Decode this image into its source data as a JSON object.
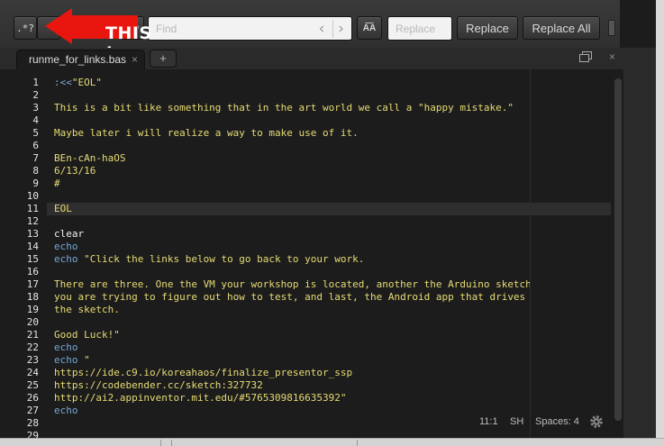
{
  "find_bar": {
    "regex_label": ".*?",
    "find_placeholder": "Find",
    "prev_glyph": "‹",
    "next_glyph": "›",
    "preserve_case_label": "A͞A",
    "replace_placeholder": "Replace",
    "replace_label": "Replace",
    "replace_all_label": "Replace All"
  },
  "annotation": {
    "text": "THIS !",
    "color": "#e8160f"
  },
  "tabs": {
    "active_tab_label": "runme_for_links.bas",
    "close_glyph": "×",
    "add_glyph": "+",
    "panel_close_glyph": "×"
  },
  "editor": {
    "active_line": 11,
    "lines": [
      {
        "n": "1",
        "segments": [
          {
            "t": ":<<",
            "c": "op"
          },
          {
            "t": "\"EOL\"",
            "c": "text"
          }
        ]
      },
      {
        "n": "2",
        "segments": []
      },
      {
        "n": "3",
        "segments": [
          {
            "t": "This is a bit like something that in the art world we call a \"happy mistake.\"",
            "c": "text"
          }
        ]
      },
      {
        "n": "4",
        "segments": []
      },
      {
        "n": "5",
        "segments": [
          {
            "t": "Maybe later i will realize a way to make use of it.",
            "c": "text"
          }
        ]
      },
      {
        "n": "6",
        "segments": []
      },
      {
        "n": "7",
        "segments": [
          {
            "t": "BEn-cAn-haOS",
            "c": "text"
          }
        ]
      },
      {
        "n": "8",
        "segments": [
          {
            "t": "6/13/16",
            "c": "text"
          }
        ]
      },
      {
        "n": "9",
        "segments": [
          {
            "t": "#",
            "c": "text"
          }
        ]
      },
      {
        "n": "10",
        "segments": []
      },
      {
        "n": "11",
        "segments": [
          {
            "t": "EOL",
            "c": "text"
          }
        ]
      },
      {
        "n": "12",
        "segments": []
      },
      {
        "n": "13",
        "segments": [
          {
            "t": "clear",
            "c": "plain"
          }
        ]
      },
      {
        "n": "14",
        "segments": [
          {
            "t": "echo",
            "c": "kw"
          }
        ]
      },
      {
        "n": "15",
        "segments": [
          {
            "t": "echo ",
            "c": "kw"
          },
          {
            "t": "\"Click the links below to go back to your work.",
            "c": "text"
          }
        ]
      },
      {
        "n": "16",
        "segments": []
      },
      {
        "n": "17",
        "segments": [
          {
            "t": "There are three. One the VM your workshop is located, another the Arduino sketch",
            "c": "text"
          }
        ]
      },
      {
        "n": "18",
        "segments": [
          {
            "t": "you are trying to figure out how to test, and last, the Android app that drives",
            "c": "text"
          }
        ]
      },
      {
        "n": "19",
        "segments": [
          {
            "t": "the sketch.",
            "c": "text"
          }
        ]
      },
      {
        "n": "20",
        "segments": []
      },
      {
        "n": "21",
        "segments": [
          {
            "t": "Good Luck!\"",
            "c": "text"
          }
        ]
      },
      {
        "n": "22",
        "segments": [
          {
            "t": "echo",
            "c": "kw"
          }
        ]
      },
      {
        "n": "23",
        "segments": [
          {
            "t": "echo ",
            "c": "kw"
          },
          {
            "t": "\"",
            "c": "text"
          }
        ]
      },
      {
        "n": "24",
        "segments": [
          {
            "t": "https://ide.c9.io/koreahaos/finalize_presentor_ssp",
            "c": "text"
          }
        ]
      },
      {
        "n": "25",
        "segments": [
          {
            "t": "https://codebender.cc/sketch:327732",
            "c": "text"
          }
        ]
      },
      {
        "n": "26",
        "segments": [
          {
            "t": "http://ai2.appinventor.mit.edu/#5765309816635392\"",
            "c": "text"
          }
        ]
      },
      {
        "n": "27",
        "segments": [
          {
            "t": "echo",
            "c": "kw"
          }
        ]
      },
      {
        "n": "28",
        "segments": []
      },
      {
        "n": "29",
        "segments": []
      }
    ]
  },
  "status": {
    "cursor": "11:1",
    "mode": "SH",
    "indent": "Spaces: 4"
  }
}
